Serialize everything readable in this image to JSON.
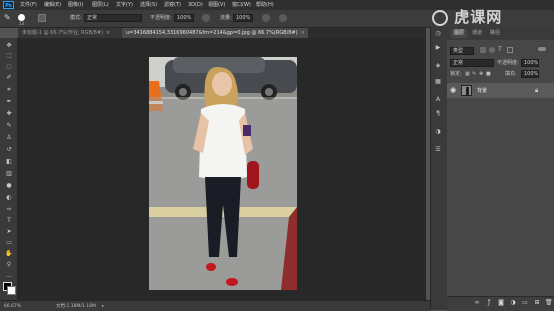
{
  "menu": {
    "logo": "Ps",
    "items": [
      "文件(F)",
      "编辑(E)",
      "图像(I)",
      "图层(L)",
      "文字(Y)",
      "选择(S)",
      "滤镜(T)",
      "3D(D)",
      "视图(V)",
      "窗口(W)",
      "帮助(H)"
    ]
  },
  "options": {
    "brush_size": "13",
    "mode_label": "模式:",
    "mode_value": "正常",
    "opacity_label": "不透明度:",
    "opacity_value": "100%",
    "flow_label": "流量:",
    "flow_value": "100%"
  },
  "tabs": [
    {
      "label": "未标题-1 @ 66.7%(作业, RGB/8#)",
      "close": "×",
      "active": false
    },
    {
      "label": "u=3416884154,3316960487&fm=214&gp=0.jpg @ 66.7%(RGB/8#)",
      "close": "×",
      "active": true
    }
  ],
  "status": {
    "zoom": "66.67%",
    "doc": "文档:1.18M/1.18M"
  },
  "layers_panel": {
    "tabs": [
      "图层",
      "通道",
      "路径"
    ],
    "kind_label": "类型",
    "blend_mode": "正常",
    "opacity_label": "不透明度:",
    "opacity_value": "100%",
    "lock_label": "锁定:",
    "fill_label": "填充:",
    "fill_value": "100%",
    "layer_name": "背景"
  },
  "watermark": "虎课网",
  "colors": {
    "menubar": "#2f2f2f",
    "canvas_bg": "#282828",
    "panel_bg": "#474747",
    "accent": "#31a8ff"
  }
}
